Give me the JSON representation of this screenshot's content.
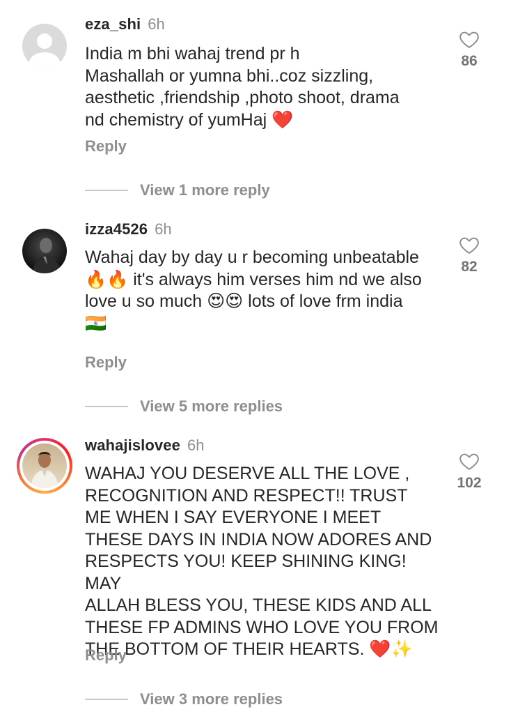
{
  "comments": [
    {
      "username": "eza_shi",
      "time": "6h",
      "text": "India m bhi wahaj trend pr h\nMashallah  or yumna bhi..coz  sizzling,\naesthetic ,friendship ,photo shoot, drama\nnd chemistry  of yumHaj ❤️",
      "reply_label": "Reply",
      "view_more_label": "View 1 more reply",
      "likes": "86",
      "avatar": "default-avatar-icon"
    },
    {
      "username": "izza4526",
      "time": "6h",
      "text": "Wahaj day by day u r becoming unbeatable\n🔥🔥 it's always him verses him nd we also\nlove u so much 😍😍 lots of love frm india\n🇮🇳",
      "reply_label": "Reply",
      "view_more_label": "View 5 more replies",
      "likes": "82",
      "avatar": "dark-photo-avatar"
    },
    {
      "username": "wahajislovee",
      "time": "6h",
      "text": "WAHAJ YOU DESERVE ALL THE LOVE ,\nRECOGNITION AND RESPECT!! TRUST\nME WHEN I SAY EVERYONE I MEET\nTHESE DAYS IN INDIA NOW ADORES AND\nRESPECTS YOU! KEEP SHINING KING! MAY\nALLAH BLESS YOU, THESE KIDS AND ALL\nTHESE FP ADMINS WHO LOVE YOU FROM\nTHE BOTTOM OF THEIR HEARTS. ❤️✨",
      "reply_label": "Reply",
      "view_more_label": "View 3 more replies",
      "likes": "102",
      "avatar": "story-ring-photo-avatar"
    }
  ],
  "colors": {
    "text": "#262626",
    "secondary": "#8e8e8e",
    "divider": "#c7c7c7",
    "story_ring_start": "#fcaf45",
    "story_ring_end": "#e1306c"
  }
}
